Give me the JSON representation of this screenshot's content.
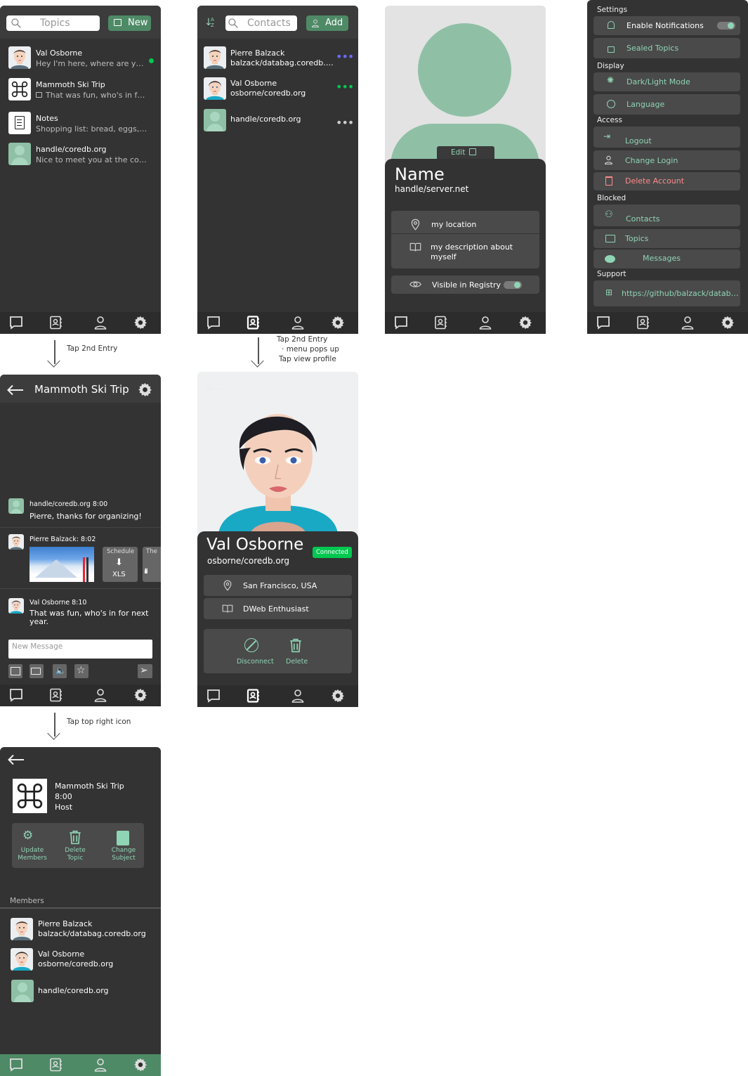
{
  "topics_screen": {
    "search_placeholder": "Topics",
    "new_button": "New",
    "items": [
      {
        "title": "Val Osborne",
        "preview": "Hey I'm here, where are you ..."
      },
      {
        "title": "Mammoth Ski Trip",
        "preview": "That was fun, who's in for ..."
      },
      {
        "title": "Notes",
        "preview": "Shopping list: bread, eggs, m..."
      },
      {
        "title": "handle/coredb.org",
        "preview": "Nice to meet you at the confer..."
      }
    ]
  },
  "contacts_screen": {
    "search_placeholder": "Contacts",
    "add_button": "Add",
    "sort_icon_text": "A Z",
    "items": [
      {
        "name": "Pierre Balzack",
        "handle": "balzack/databag.coredb.org"
      },
      {
        "name": "Val Osborne",
        "handle": "osborne/coredb.org"
      },
      {
        "name": "handle/coredb.org",
        "handle": ""
      }
    ]
  },
  "profile_screen": {
    "edit_label": "Edit",
    "name": "Name",
    "handle": "handle/server.net",
    "location": "my location",
    "description": "my description about myself",
    "registry_label": "Visible in Registry"
  },
  "settings_screen": {
    "sections": {
      "settings": "Settings",
      "display": "Display",
      "access": "Access",
      "blocked": "Blocked",
      "support": "Support"
    },
    "enable_notifications": "Enable Notifications",
    "sealed_topics": "Sealed Topics",
    "dark_light": "Dark/Light Mode",
    "language": "Language",
    "logout": "Logout",
    "change_login": "Change Login",
    "delete_account": "Delete Account",
    "blocked_contacts": "Contacts",
    "blocked_topics": "Topics",
    "blocked_messages": "Messages",
    "support_link": "https://github/balzack/databag"
  },
  "annotations": {
    "a1": "Tap 2nd Entry",
    "a2_line1": "Tap 2nd Entry",
    "a2_line2": "menu pops up",
    "a2_line3": "Tap view profile",
    "a3": "Tap top right icon"
  },
  "conversation_screen": {
    "title": "Mammoth Ski Trip",
    "messages": [
      {
        "header": "handle/coredb.org 8:00",
        "body": "Pierre, thanks for organizing!"
      },
      {
        "header": "Pierre Balzack: 8:02",
        "body": ""
      },
      {
        "header": "Val Osborne  8:10",
        "body": "That was fun, who's in for next year."
      }
    ],
    "attachment_schedule": "Schedule",
    "attachment_xls": "XLS",
    "attachment_third": "The",
    "new_message_placeholder": "New Message"
  },
  "contact_profile_screen": {
    "name": "Val Osborne",
    "handle": "osborne/coredb.org",
    "status": "Connected",
    "location": "San Francisco, USA",
    "description": "DWeb Enthusiast",
    "disconnect": "Disconnect",
    "delete": "Delete"
  },
  "topic_settings_screen": {
    "title": "Mammoth Ski Trip",
    "time": "8:00",
    "role": "Host",
    "update_members": "Update Members",
    "delete_topic": "Delete Topic",
    "change_subject": "Change Subject",
    "members_label": "Members",
    "members": [
      {
        "name": "Pierre Balzack",
        "handle": "balzack/databag.coredb.org"
      },
      {
        "name": "Val Osborne",
        "handle": "osborne/coredb.org"
      },
      {
        "name": "handle/coredb.org",
        "handle": ""
      }
    ]
  },
  "colors": {
    "accent_green": "#4e8a66",
    "mint": "#8fd4b4",
    "danger": "#ff8a8a",
    "online": "#00c850",
    "panel": "#333333"
  }
}
